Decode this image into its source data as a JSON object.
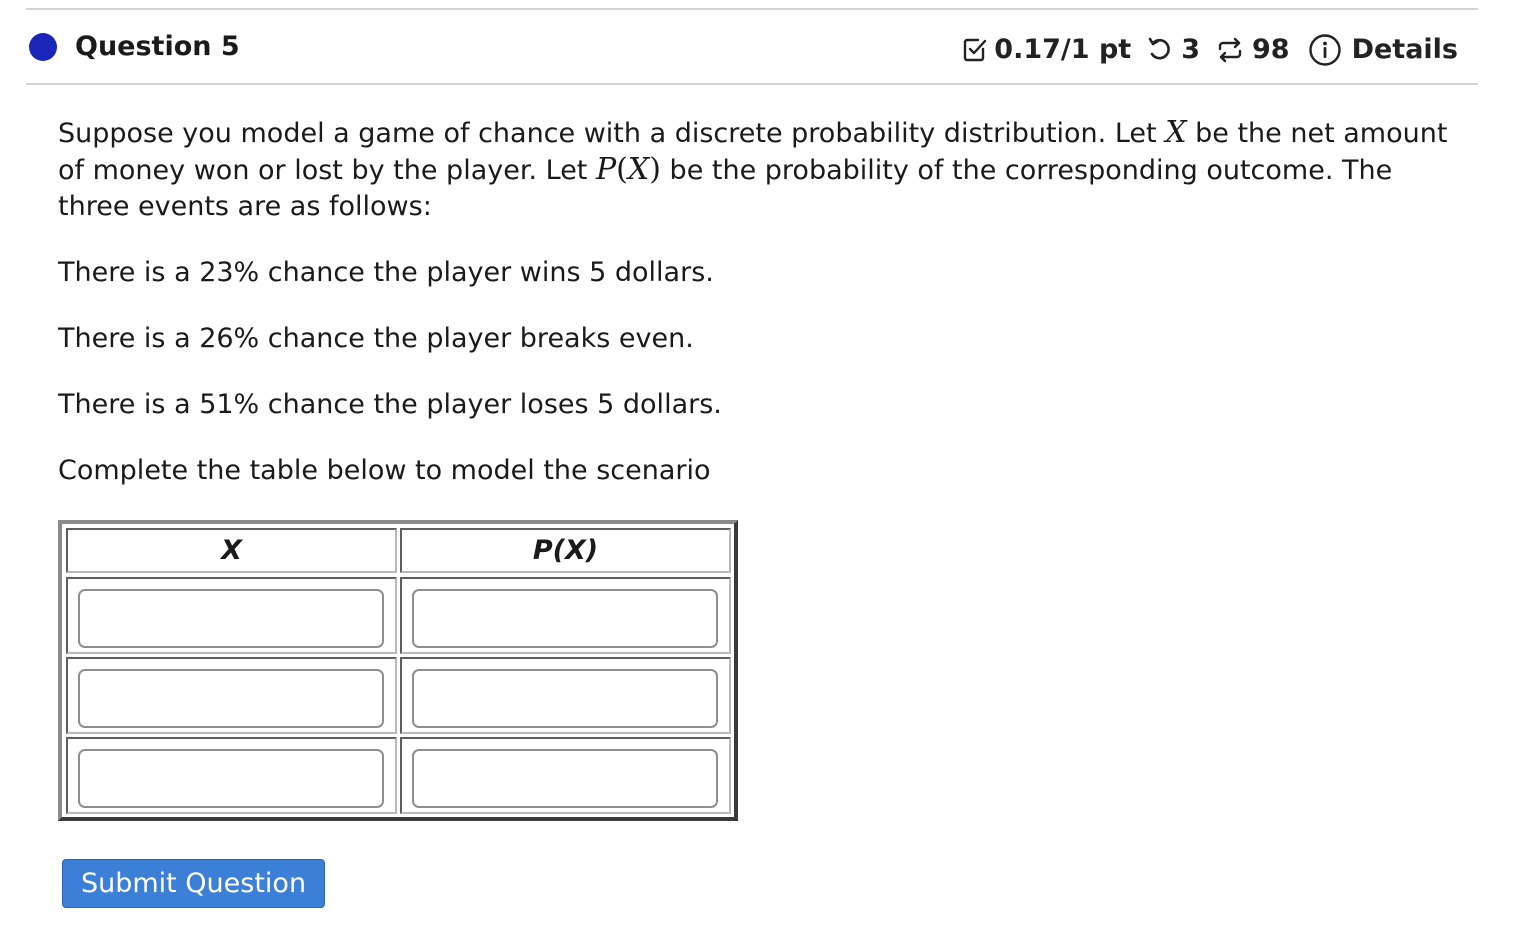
{
  "header": {
    "question_label": "Question 5",
    "score": "0.17/1 pt",
    "retries": "3",
    "attempts": "98",
    "details_label": "Details",
    "icons": {
      "status_dot": "status-dot-icon",
      "score": "checkbox-check-icon",
      "retries": "undo-arrow-icon",
      "attempts": "repeat-arrows-icon",
      "details": "info-circle-icon"
    },
    "colors": {
      "status_dot": "#1a26b8"
    }
  },
  "prompt": {
    "part1": "Suppose you model a game of chance with a discrete probability distribution. Let ",
    "var_x": "X",
    "part2": " be the net amount of money won or lost by the player. Let ",
    "var_p": "P",
    "paren_open": "(",
    "paren_close": ")",
    "part3": " be the probability of the corresponding outcome. The three events are as follows:"
  },
  "events": [
    "There is a 23% chance the player wins 5 dollars.",
    "There is a 26% chance the player breaks even.",
    "There is a 51% chance the player loses 5 dollars."
  ],
  "instruction": "Complete the table below to model the scenario",
  "table": {
    "headers": [
      "X",
      "P(X)"
    ],
    "rows": [
      {
        "x": "",
        "px": ""
      },
      {
        "x": "",
        "px": ""
      },
      {
        "x": "",
        "px": ""
      }
    ]
  },
  "submit_label": "Submit Question",
  "colors": {
    "button": "#3c7fd6"
  }
}
